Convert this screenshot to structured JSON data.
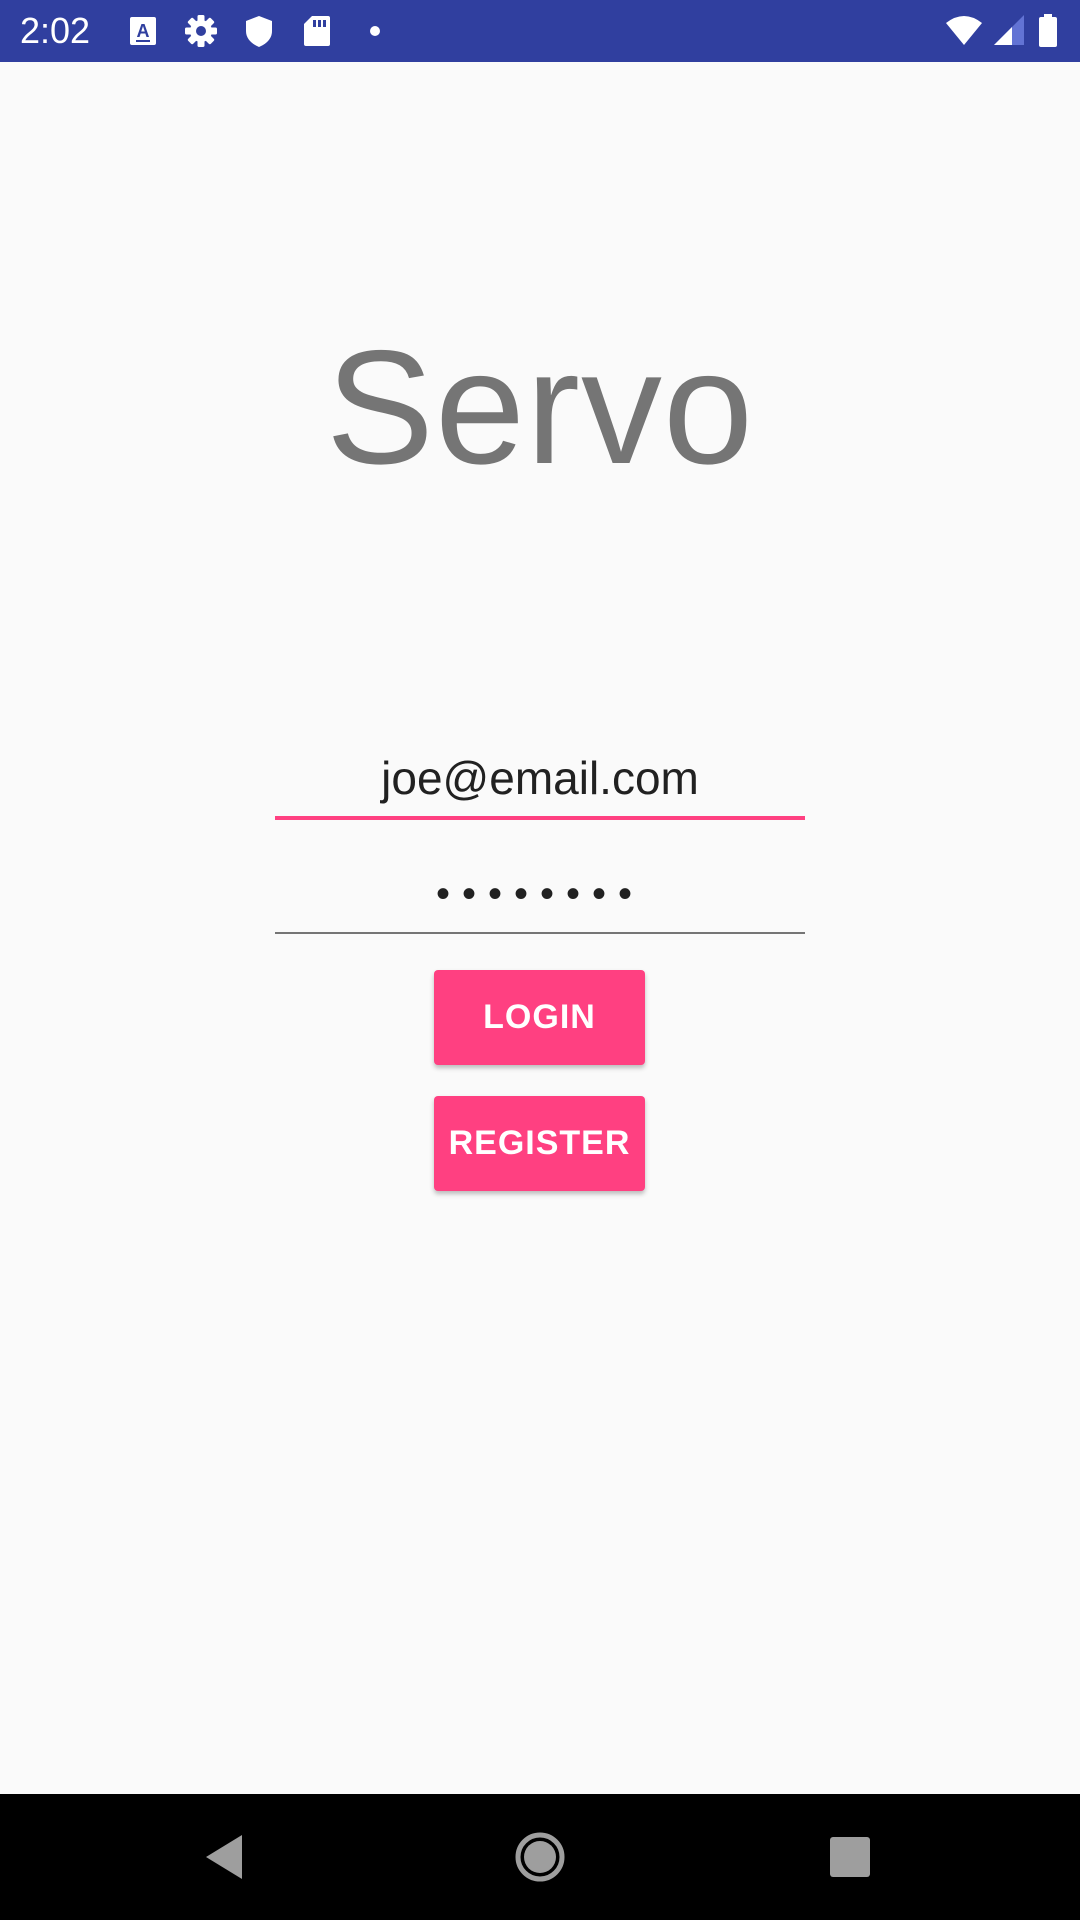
{
  "status_bar": {
    "time": "2:02",
    "background_color": "#303f9f",
    "left_icons": [
      "text-a-icon",
      "gear-icon",
      "shield-icon",
      "sd-card-icon",
      "dot-icon"
    ],
    "right_icons": [
      "wifi-icon",
      "signal-icon",
      "battery-icon"
    ]
  },
  "app": {
    "title": "Servo"
  },
  "login_form": {
    "email_value": "joe@email.com",
    "password_value": "••••••••",
    "login_label": "LOGIN",
    "register_label": "REGISTER"
  },
  "colors": {
    "accent": "#ff4081",
    "title_gray": "#757575",
    "background": "#fafafa"
  },
  "nav_bar": {
    "icons": [
      "back-icon",
      "home-icon",
      "recents-icon"
    ]
  }
}
